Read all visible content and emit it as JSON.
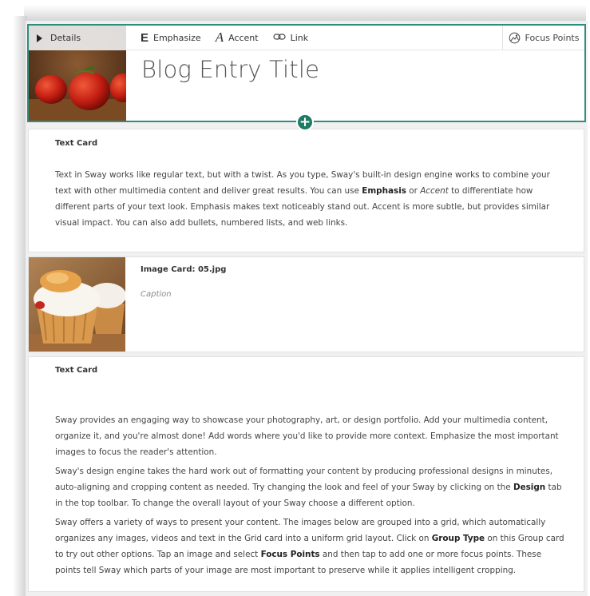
{
  "title_card": {
    "details_label": "Details",
    "toolbar": {
      "emphasize_label": "Emphasize",
      "accent_label": "Accent",
      "link_label": "Link",
      "focus_points_label": "Focus Points"
    },
    "title": "Blog Entry Title",
    "add_symbol": "+"
  },
  "text_card_1": {
    "label": "Text Card",
    "body": {
      "t1": "Text in Sway works like regular text, but with a twist. As you type, Sway's built-in design engine works to combine your text with other multimedia content and deliver great results. You can use ",
      "emphasis": "Emphasis",
      "t2": " or ",
      "accent": "Accent",
      "t3": " to differentiate how different parts of your text look. Emphasis makes text noticeably stand out. Accent is more subtle, but provides similar visual impact. You can also add bullets, numbered lists, and web links."
    }
  },
  "image_card": {
    "label": "Image Card: 05.jpg",
    "caption": "Caption"
  },
  "text_card_2": {
    "label": "Text Card",
    "p1": "Sway provides an engaging way to showcase your photography, art, or design portfolio.  Add your multimedia content, organize it, and you're almost done!  Add words where you'd like to provide more context.  Emphasize the most important images to focus the reader's attention.",
    "p2": {
      "t1": "Sway's design engine takes the hard work out of formatting your content by producing professional designs in minutes, auto-aligning and cropping content as needed.  Try changing the look and feel of your Sway by clicking on the ",
      "b1": "Design",
      "t2": " tab in the top toolbar.  To change the overall layout of your Sway choose a different option."
    },
    "p3": {
      "t1": "Sway offers a variety of ways to present your content.  The images below are grouped into a grid, which automatically organizes any images, videos and text in the Grid card into a uniform grid layout.  Click on ",
      "b1": "Group Type",
      "t2": " on this Group card to try out other options.  Tap an image and select ",
      "b2": "Focus Points",
      "t3": " and then tap to add one or more focus points. These points tell Sway which parts of your image are most important to preserve while it applies intelligent cropping."
    }
  },
  "colors": {
    "selection_border": "#2e8e7e",
    "add_button": "#1f7a66"
  }
}
